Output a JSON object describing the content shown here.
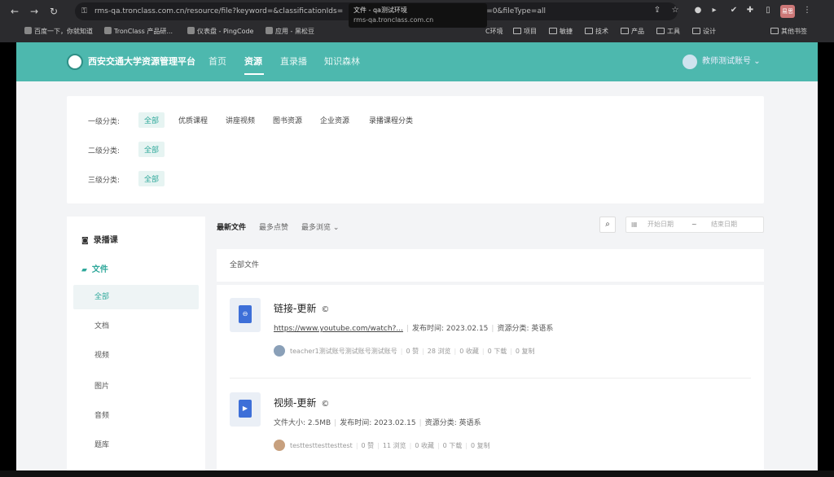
{
  "browser": {
    "url": "rms-qa.tronclass.com.cn/resource/file?keyword=&classificationIds=",
    "url_tail": "=0&fileType=all",
    "tooltip_title": "文件 - qa测试环境",
    "tooltip_host": "rms-qa.tronclass.com.cn",
    "profile": "易思",
    "bookmarks": [
      "百度一下，你就知道",
      "TronClass 产品研...",
      "仪表盘 - PingCode",
      "应用 - 黑松豆",
      "C环境",
      "项目",
      "敏捷",
      "技术",
      "产品",
      "工具",
      "设计",
      "其他书签"
    ]
  },
  "topnav": {
    "brand": "西安交通大学资源管理平台",
    "items": [
      "首页",
      "资源",
      "直录播",
      "知识森林"
    ],
    "active_index": 1,
    "user": "教师测试账号"
  },
  "filters": [
    {
      "label": "一级分类:",
      "options": [
        "全部",
        "优质课程",
        "讲座视频",
        "图书资源",
        "企业资源",
        "录播课程分类"
      ]
    },
    {
      "label": "二级分类:",
      "options": [
        "全部"
      ]
    },
    {
      "label": "三级分类:",
      "options": [
        "全部"
      ]
    }
  ],
  "sidebar": {
    "lecture": "录播课",
    "files": "文件",
    "items": [
      "全部",
      "文档",
      "视频",
      "图片",
      "音频",
      "题库"
    ]
  },
  "sort": {
    "options": [
      "最新文件",
      "最多点赞",
      "最多浏览"
    ],
    "start_placeholder": "开始日期",
    "end_placeholder": "结束日期"
  },
  "list": {
    "header": "全部文件",
    "items": [
      {
        "title": "链接-更新",
        "link": "https://www.youtube.com/watch?...",
        "publish": "发布时间: 2023.02.15",
        "category": "资源分类: 英语系",
        "author": "teacher1测试账号测试账号测试账号",
        "likes": "0 赞",
        "views": "28 浏览",
        "favs": "0 收藏",
        "downloads": "0 下载",
        "copies": "0 复制"
      },
      {
        "title": "视频-更新",
        "size": "文件大小: 2.5MB",
        "publish": "发布时间: 2023.02.15",
        "category": "资源分类: 英语系",
        "author": "testtesttesttesttest",
        "likes": "0 赞",
        "views": "11 浏览",
        "favs": "0 收藏",
        "downloads": "0 下载",
        "copies": "0 复制"
      }
    ]
  }
}
